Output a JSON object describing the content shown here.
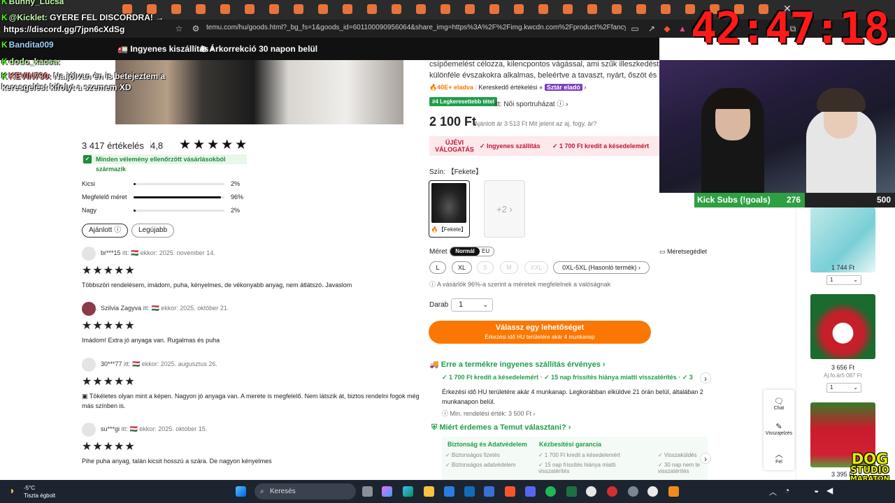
{
  "browser": {
    "url": "temu.com/hu/goods.html?_bg_fs=1&goods_id=601100090956064&share_img=https%3A%2F%2Fimg.kwcdn.com%2Fproduct%2Ffancy%2F941...",
    "close_glyph": "✕"
  },
  "stream": {
    "timer": "42:47:18",
    "subs_label": "Kick Subs (!goals)",
    "subs_current": "276",
    "subs_goal": "500",
    "subs_progress": 0.552,
    "dog_line1": "DOG",
    "dog_line2": "STUDIO",
    "dog_line3": "MARATON"
  },
  "chat": [
    {
      "user": "Bunny_Lucsa",
      "text": ""
    },
    {
      "user": "@Kicklet:",
      "text": "GYERE FEL DISCORDRA! →"
    },
    {
      "user": "",
      "text": "https://discord.gg/7jpn6cXdSg"
    },
    {
      "user": "Bandita009",
      "text": ""
    },
    {
      "user": "dodo_kacsa:",
      "text": ""
    },
    {
      "user": "KEVIN730:",
      "text": "Na jólvan én is betejeztem a"
    },
    {
      "user": "",
      "text": "keresgelést kifolyt a szemem XD"
    }
  ],
  "promo": {
    "shipping": "Ingyenes kiszállítás",
    "price_correction": "Árkorrekció 30 napon belül"
  },
  "reviews_summary": {
    "count": "3 417 értékelés",
    "score": "4,8",
    "verified": "Minden vélemény ellenőrzött vásárlásokból származik",
    "fit": [
      {
        "label": "Kicsi",
        "pct": "2%",
        "value": 0.02
      },
      {
        "label": "Megfelelő méret",
        "pct": "96%",
        "value": 0.96
      },
      {
        "label": "Nagy",
        "pct": "2%",
        "value": 0.02
      }
    ],
    "sort_recommended": "Ajánlott",
    "sort_latest": "Legújabb"
  },
  "reviews": [
    {
      "name": "br***15",
      "meta": "itt: 🇭🇺 ekkor: 2025. november 14.",
      "stars": "★★★★★",
      "text": "Többszöri rendelésem, imádom, puha, kényelmes, de vékonyabb anyag, nem átlátszó. Javaslom"
    },
    {
      "name": "Szilvia Zagyva",
      "meta": "itt: 🇭🇺 ekkor: 2025. október 21.",
      "stars": "★★★★★",
      "text": "Imádom! Extra jó anyaga van. Rugalmas és puha"
    },
    {
      "name": "30***77",
      "meta": "itt: 🇭🇺 ekkor: 2025. augusztus 26.",
      "stars": "★★★★★",
      "text": "Tökéletes olyan mint a képen. Nagyon jó anyaga van. A merete is megfelelő. Nem látszik át, biztos rendelni fogok még más színben is."
    },
    {
      "name": "su***gi",
      "meta": "itt: 🇭🇺 ekkor: 2025. október 15.",
      "stars": "★★★★★",
      "text": "Pihe puha anyag, talán kicsit hosszú a szára. De nagyon kényelmes"
    }
  ],
  "product": {
    "desc_line1": "csípőemelést célozza, kilencpontos vágással, ami szűk illeszkedést bizt",
    "desc_line2": "különféle évszakokra alkalmas, beleértve a tavaszt, nyárt, őszöt és télet",
    "sold": "40E+ eladva",
    "seller_rating": "Kereskedő értékelési",
    "star_seller": "Sztár eladó",
    "best_badge": "#4 Legkeresettebb tétel",
    "best_category": "itt: Női sportruházat",
    "price": "2 100 Ft",
    "price_note": "Ajánlott ár 3 513 Ft  Mit jelent az aj. fogy. ár?",
    "new_buyer": "ÚJÉVI VÁLOGATÁS",
    "perk1": "✓ Ingyenes szállítás",
    "perk2": "✓ 1 700 Ft kredit a késedelemért",
    "color_label": "Szín: 【Fekete】",
    "swatch_caption": "🔥【Fekete】",
    "more_colors": "+2 ›",
    "size_label": "Méret",
    "size_system_on": "Normál",
    "size_system_off": "EU",
    "size_guide": "Méretsegédlet",
    "sizes": [
      "L",
      "XL",
      "S",
      "M",
      "XXL",
      "0XL-5XL (Hasonló termék) ›"
    ],
    "size_note": "ⓘ A vásárlók 96%-a szerint a méretek megfelelnek a valóságnak",
    "qty_label": "Darab",
    "qty_value": "1",
    "cta_main": "Válassz egy lehetőséget",
    "cta_sub": "Érkezési idő HU területére akár 4 munkanap",
    "ship_title": "Erre a termékre ingyenes szállítás érvényes ›",
    "ship_perks": "✓ 1 700 Ft kredit a késedelemért  ·  ✓ 15 nap frissítés hiánya miatti visszatérítés  ·  ✓ 3",
    "ship_text": "Érkezési idő HU területére akár 4 munkanap. Legkorábban elküldve 21 órán belül, általában 2 munkanapon belül.",
    "min_order": "ⓘ Min. rendelési érték: 3 500 Ft ›",
    "why_title": "Miért érdemes a Temut választani? ›",
    "panel": {
      "col1_title": "Biztonság és Adatvédelem",
      "col1_items": [
        "✓ Biztonságos fizetés",
        "✓ Biztonságos adatvédelem"
      ],
      "col2_title": "Kézbesítési garancia",
      "col2_items": [
        "✓ 1 700 Ft kredit a késedelemért",
        "✓ 15 nap frissítés hiánya miatti visszatérítés"
      ],
      "col3_items": [
        "✓ Visszaküldés",
        "✓ 30 nap nem te visszatérítés"
      ]
    }
  },
  "sidebar": {
    "items": [
      {
        "price": "1 744 Ft",
        "old": "",
        "qty": "1"
      },
      {
        "price": "3 656 Ft",
        "old": "Aj.fo.ár5 087 Ft",
        "qty": "1"
      },
      {
        "price": "3 395 Ft",
        "old": "",
        "qty": ""
      }
    ],
    "chat": "Chat",
    "feedback": "Visszajelzés",
    "up": "Fel"
  },
  "taskbar": {
    "temp": "-5°C",
    "weather": "Tiszta égbolt",
    "search": "Keresés"
  },
  "colors": {
    "accent": "#fb7701",
    "green": "#1e9e4a",
    "kick_green": "#53fc18",
    "timer_red": "#ff1a1a"
  }
}
